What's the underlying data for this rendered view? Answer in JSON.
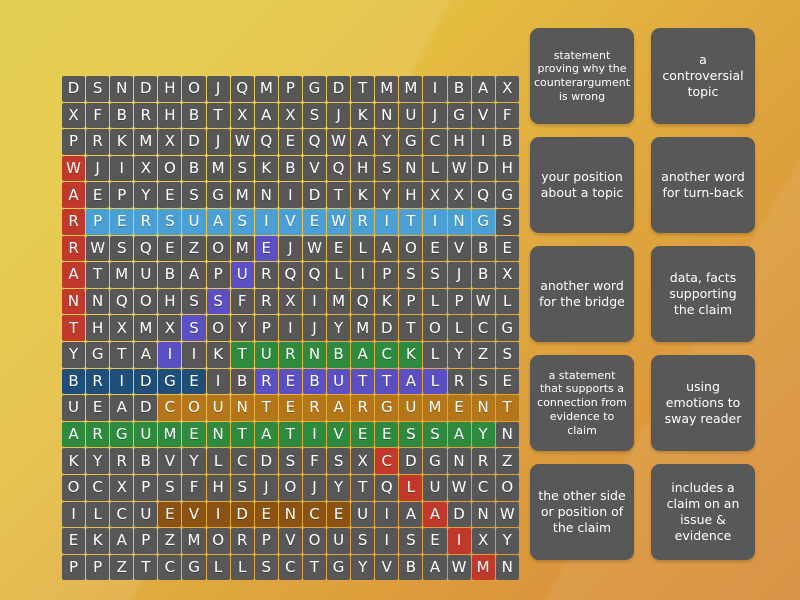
{
  "background": {
    "gradient_start": "#e0c93f",
    "gradient_end": "#d68c39"
  },
  "palette": {
    "cell_bg": "#575757",
    "cell_text": "#ffffff",
    "card_bg": "#585858",
    "highlight_red": "#c0392b",
    "highlight_blue": "#4a9fd4",
    "highlight_purple": "#5b4fc4",
    "highlight_navy": "#1f4e79",
    "highlight_green": "#2e8b3d",
    "highlight_brown": "#b5761a",
    "highlight_darkbrown": "#8a5213"
  },
  "grid": {
    "columns": 19,
    "rows": 18,
    "rows_data": [
      {
        "letters": [
          "D",
          "S",
          "N",
          "D",
          "H",
          "O",
          "J",
          "Q",
          "M",
          "P",
          "G",
          "D",
          "T",
          "M",
          "M",
          "I",
          "B",
          "A",
          "X"
        ],
        "highlights": [
          "",
          "",
          "",
          "",
          "",
          "",
          "",
          "",
          "",
          "",
          "",
          "",
          "",
          "",
          "",
          "",
          "",
          "",
          ""
        ]
      },
      {
        "letters": [
          "X",
          "F",
          "B",
          "R",
          "H",
          "B",
          "T",
          "X",
          "A",
          "X",
          "S",
          "J",
          "K",
          "N",
          "U",
          "J",
          "G",
          "V",
          "F"
        ],
        "highlights": [
          "",
          "",
          "",
          "",
          "",
          "",
          "",
          "",
          "",
          "",
          "",
          "",
          "",
          "",
          "",
          "",
          "",
          "",
          ""
        ]
      },
      {
        "letters": [
          "P",
          "R",
          "K",
          "M",
          "X",
          "D",
          "J",
          "W",
          "Q",
          "E",
          "Q",
          "W",
          "A",
          "Y",
          "G",
          "C",
          "H",
          "I",
          "B"
        ],
        "highlights": [
          "",
          "",
          "",
          "",
          "",
          "",
          "",
          "",
          "",
          "",
          "",
          "",
          "",
          "",
          "",
          "",
          "",
          "",
          ""
        ]
      },
      {
        "letters": [
          "W",
          "J",
          "I",
          "X",
          "O",
          "B",
          "M",
          "S",
          "K",
          "B",
          "V",
          "Q",
          "H",
          "S",
          "N",
          "L",
          "W",
          "D",
          "H"
        ],
        "highlights": [
          "red",
          "",
          "",
          "",
          "",
          "",
          "",
          "",
          "",
          "",
          "",
          "",
          "",
          "",
          "",
          "",
          "",
          "",
          ""
        ]
      },
      {
        "letters": [
          "A",
          "E",
          "P",
          "Y",
          "E",
          "S",
          "G",
          "M",
          "N",
          "I",
          "D",
          "T",
          "K",
          "Y",
          "H",
          "X",
          "X",
          "Q",
          "G"
        ],
        "highlights": [
          "red",
          "",
          "",
          "",
          "",
          "",
          "",
          "",
          "",
          "",
          "",
          "",
          "",
          "",
          "",
          "",
          "",
          "",
          ""
        ]
      },
      {
        "letters": [
          "R",
          "P",
          "E",
          "R",
          "S",
          "U",
          "A",
          "S",
          "I",
          "V",
          "E",
          "W",
          "R",
          "I",
          "T",
          "I",
          "N",
          "G",
          "S"
        ],
        "highlights": [
          "red",
          "blue",
          "blue",
          "blue",
          "blue",
          "blue",
          "blue",
          "blue",
          "blue",
          "blue",
          "blue",
          "blue",
          "blue",
          "blue",
          "blue",
          "blue",
          "blue",
          "blue",
          ""
        ]
      },
      {
        "letters": [
          "R",
          "W",
          "S",
          "Q",
          "E",
          "Z",
          "O",
          "M",
          "E",
          "J",
          "W",
          "E",
          "L",
          "A",
          "O",
          "E",
          "V",
          "B",
          "E"
        ],
        "highlights": [
          "red",
          "",
          "",
          "",
          "",
          "",
          "",
          "",
          "purple",
          "",
          "",
          "",
          "",
          "",
          "",
          "",
          "",
          "",
          ""
        ]
      },
      {
        "letters": [
          "A",
          "T",
          "M",
          "U",
          "B",
          "A",
          "P",
          "U",
          "R",
          "Q",
          "Q",
          "L",
          "I",
          "P",
          "S",
          "S",
          "J",
          "B",
          "X"
        ],
        "highlights": [
          "red",
          "",
          "",
          "",
          "",
          "",
          "",
          "purple",
          "",
          "",
          "",
          "",
          "",
          "",
          "",
          "",
          "",
          "",
          ""
        ]
      },
      {
        "letters": [
          "N",
          "N",
          "Q",
          "O",
          "H",
          "S",
          "S",
          "F",
          "R",
          "X",
          "I",
          "M",
          "Q",
          "K",
          "P",
          "L",
          "P",
          "W",
          "L"
        ],
        "highlights": [
          "red",
          "",
          "",
          "",
          "",
          "",
          "purple",
          "",
          "",
          "",
          "",
          "",
          "",
          "",
          "",
          "",
          "",
          "",
          ""
        ]
      },
      {
        "letters": [
          "T",
          "H",
          "X",
          "M",
          "X",
          "S",
          "O",
          "Y",
          "P",
          "I",
          "J",
          "Y",
          "M",
          "D",
          "T",
          "O",
          "L",
          "C",
          "G"
        ],
        "highlights": [
          "red",
          "",
          "",
          "",
          "",
          "purple",
          "",
          "",
          "",
          "",
          "",
          "",
          "",
          "",
          "",
          "",
          "",
          "",
          ""
        ]
      },
      {
        "letters": [
          "Y",
          "G",
          "T",
          "A",
          "I",
          "I",
          "K",
          "T",
          "U",
          "R",
          "N",
          "B",
          "A",
          "C",
          "K",
          "L",
          "Y",
          "Z",
          "S"
        ],
        "highlights": [
          "",
          "",
          "",
          "",
          "purple",
          "",
          "",
          "green",
          "green",
          "green",
          "green",
          "green",
          "green",
          "green",
          "green",
          "",
          "",
          "",
          ""
        ]
      },
      {
        "letters": [
          "B",
          "R",
          "I",
          "D",
          "G",
          "E",
          "I",
          "B",
          "R",
          "E",
          "B",
          "U",
          "T",
          "T",
          "A",
          "L",
          "R",
          "S",
          "E"
        ],
        "highlights": [
          "navy",
          "navy",
          "navy",
          "navy",
          "navy",
          "navy",
          "",
          "",
          "purple",
          "purple",
          "purple",
          "purple",
          "purple",
          "purple",
          "purple",
          "purple",
          "",
          "",
          ""
        ]
      },
      {
        "letters": [
          "U",
          "E",
          "A",
          "D",
          "C",
          "O",
          "U",
          "N",
          "T",
          "E",
          "R",
          "A",
          "R",
          "G",
          "U",
          "M",
          "E",
          "N",
          "T"
        ],
        "highlights": [
          "",
          "",
          "",
          "",
          "brown",
          "brown",
          "brown",
          "brown",
          "brown",
          "brown",
          "brown",
          "brown",
          "brown",
          "brown",
          "brown",
          "brown",
          "brown",
          "brown",
          "brown"
        ]
      },
      {
        "letters": [
          "A",
          "R",
          "G",
          "U",
          "M",
          "E",
          "N",
          "T",
          "A",
          "T",
          "I",
          "V",
          "E",
          "E",
          "S",
          "S",
          "A",
          "Y",
          "N"
        ],
        "highlights": [
          "green",
          "green",
          "green",
          "green",
          "green",
          "green",
          "green",
          "green",
          "green",
          "green",
          "green",
          "green",
          "green",
          "green",
          "green",
          "green",
          "green",
          "green",
          ""
        ]
      },
      {
        "letters": [
          "K",
          "Y",
          "R",
          "B",
          "V",
          "Y",
          "L",
          "C",
          "D",
          "S",
          "F",
          "S",
          "X",
          "C",
          "D",
          "G",
          "N",
          "R",
          "Z"
        ],
        "highlights": [
          "",
          "",
          "",
          "",
          "",
          "",
          "",
          "",
          "",
          "",
          "",
          "",
          "",
          "red",
          "",
          "",
          "",
          "",
          ""
        ]
      },
      {
        "letters": [
          "O",
          "C",
          "X",
          "P",
          "S",
          "F",
          "H",
          "S",
          "J",
          "O",
          "J",
          "Y",
          "T",
          "Q",
          "L",
          "U",
          "W",
          "C",
          "O"
        ],
        "highlights": [
          "",
          "",
          "",
          "",
          "",
          "",
          "",
          "",
          "",
          "",
          "",
          "",
          "",
          "",
          "red",
          "",
          "",
          "",
          ""
        ]
      },
      {
        "letters": [
          "I",
          "L",
          "C",
          "U",
          "E",
          "V",
          "I",
          "D",
          "E",
          "N",
          "C",
          "E",
          "U",
          "I",
          "A",
          "A",
          "D",
          "N",
          "W"
        ],
        "highlights": [
          "",
          "",
          "",
          "",
          "darkbrown",
          "darkbrown",
          "darkbrown",
          "darkbrown",
          "darkbrown",
          "darkbrown",
          "darkbrown",
          "darkbrown",
          "",
          "",
          "",
          "red",
          "",
          "",
          ""
        ]
      },
      {
        "letters": [
          "E",
          "K",
          "A",
          "P",
          "Z",
          "M",
          "O",
          "R",
          "P",
          "V",
          "O",
          "U",
          "S",
          "I",
          "S",
          "E",
          "I",
          "X",
          "Y"
        ],
        "highlights": [
          "",
          "",
          "",
          "",
          "",
          "",
          "",
          "",
          "",
          "",
          "",
          "",
          "",
          "",
          "",
          "",
          "red",
          "",
          ""
        ]
      },
      {
        "letters": [
          "P",
          "P",
          "Z",
          "T",
          "C",
          "G",
          "L",
          "L",
          "S",
          "C",
          "T",
          "G",
          "Y",
          "V",
          "B",
          "A",
          "W",
          "M",
          "N"
        ],
        "highlights": [
          "",
          "",
          "",
          "",
          "",
          "",
          "",
          "",
          "",
          "",
          "",
          "",
          "",
          "",
          "",
          "",
          "",
          "red",
          ""
        ]
      }
    ]
  },
  "clues": [
    {
      "id": "clue-rebuttal",
      "text": "statement proving why the counterargument is wrong",
      "size": "small"
    },
    {
      "id": "clue-controversial",
      "text": "a controversial topic",
      "size": "normal"
    },
    {
      "id": "clue-claim",
      "text": "your position about a topic",
      "size": "normal"
    },
    {
      "id": "clue-turn-back",
      "text": "another word for turn-back",
      "size": "normal"
    },
    {
      "id": "clue-bridge",
      "text": "another word for the bridge",
      "size": "normal"
    },
    {
      "id": "clue-evidence",
      "text": "data, facts supporting the claim",
      "size": "normal"
    },
    {
      "id": "clue-warrant",
      "text": "a statement that supports a connection from evidence to claim",
      "size": "small"
    },
    {
      "id": "clue-pathos",
      "text": "using emotions to sway reader",
      "size": "normal"
    },
    {
      "id": "clue-counterargument",
      "text": "the other side or position of the claim",
      "size": "normal"
    },
    {
      "id": "clue-argumentative",
      "text": "includes a claim on an issue & evidence",
      "size": "normal"
    }
  ]
}
